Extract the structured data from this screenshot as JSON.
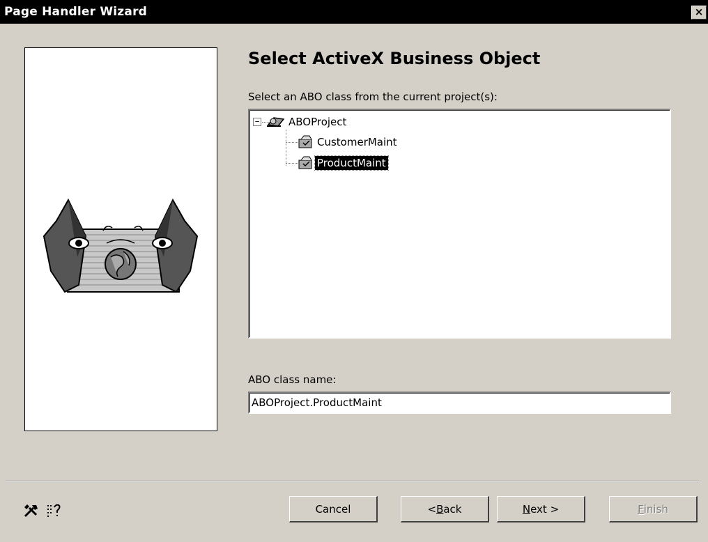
{
  "window": {
    "title": "Page Handler Wizard",
    "close_glyph": "×"
  },
  "main": {
    "heading": "Select ActiveX Business Object",
    "tree_label": "Select an ABO class from the current project(s):",
    "tree": {
      "root": {
        "label": "ABOProject",
        "expander": "−",
        "icon": "project-icon"
      },
      "children": [
        {
          "label": "CustomerMaint",
          "icon": "class-module-icon",
          "selected": false
        },
        {
          "label": "ProductMaint",
          "icon": "class-module-icon",
          "selected": true
        }
      ]
    },
    "class_name_label": "ABO class name:",
    "class_name_value": "ABOProject.ProductMaint"
  },
  "footer": {
    "tools": [
      "tools-icon",
      "wizard-settings-icon"
    ],
    "buttons": {
      "cancel": "Cancel",
      "back_prefix": "< ",
      "back_key": "B",
      "back_rest": "ack",
      "next_key": "N",
      "next_rest": "ext >",
      "finish_key": "F",
      "finish_rest": "inish"
    }
  },
  "colors": {
    "window_bg": "#d4d0c8",
    "titlebar_bg": "#000000",
    "selection_bg": "#000000"
  }
}
